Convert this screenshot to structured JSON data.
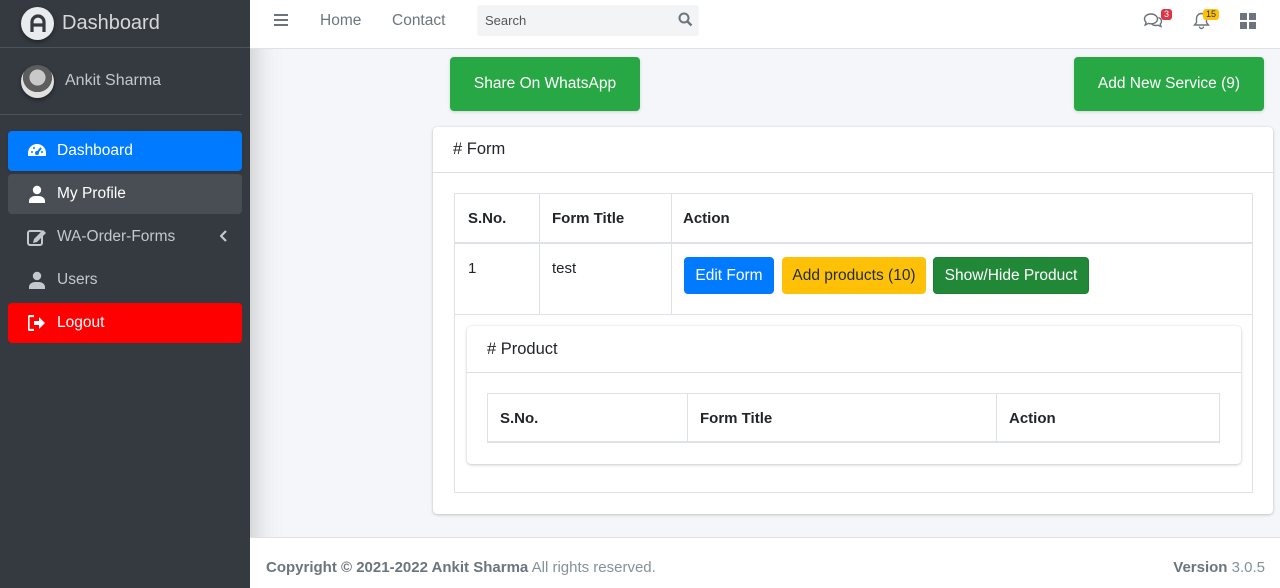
{
  "brand": {
    "title": "Dashboard"
  },
  "user": {
    "name": "Ankit Sharma"
  },
  "sidebar": {
    "items": [
      {
        "label": "Dashboard",
        "icon": "tachometer-icon"
      },
      {
        "label": "My Profile",
        "icon": "user-icon"
      },
      {
        "label": "WA-Order-Forms",
        "icon": "edit-icon"
      },
      {
        "label": "Users",
        "icon": "user-icon"
      },
      {
        "label": "Logout",
        "icon": "sign-out-icon"
      }
    ]
  },
  "topbar": {
    "links": [
      "Home",
      "Contact"
    ],
    "search_placeholder": "Search",
    "messages_count": "3",
    "notifications_count": "15"
  },
  "actions": {
    "share_label": "Share On WhatsApp",
    "add_service_label": "Add New Service (9)"
  },
  "form_card": {
    "title": "# Form",
    "columns": [
      "S.No.",
      "Form Title",
      "Action"
    ],
    "rows": [
      {
        "sno": "1",
        "title": "test",
        "edit_label": "Edit Form",
        "add_products_label": "Add products (10)",
        "show_hide_label": "Show/Hide Product"
      }
    ]
  },
  "product_card": {
    "title": "# Product",
    "columns": [
      "S.No.",
      "Form Title",
      "Action"
    ]
  },
  "footer": {
    "copyright": "Copyright © 2021-2022 Ankit Sharma",
    "rights": " All rights reserved.",
    "version_label": "Version",
    "version": " 3.0.5"
  },
  "colors": {
    "sidebar_bg": "#343a40",
    "primary": "#007bff",
    "success": "#28a745",
    "warning": "#ffc107",
    "danger": "#ff0000"
  }
}
